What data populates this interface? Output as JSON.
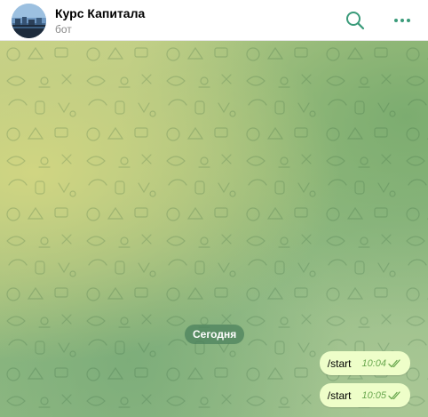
{
  "header": {
    "title": "Курс Капитала",
    "subtitle": "бот",
    "avatar_icon": "bot-avatar",
    "search_icon": "search-icon",
    "more_icon": "more-dots-icon"
  },
  "chat": {
    "date_label": "Сегодня",
    "messages": [
      {
        "text": "/start",
        "time": "10:04",
        "status": "read"
      },
      {
        "text": "/start",
        "time": "10:05",
        "status": "read"
      }
    ]
  },
  "colors": {
    "accent": "#3a9b7a",
    "bubble": "#eefec9",
    "time": "#6aa84f",
    "date_pill": "#4a805c"
  }
}
